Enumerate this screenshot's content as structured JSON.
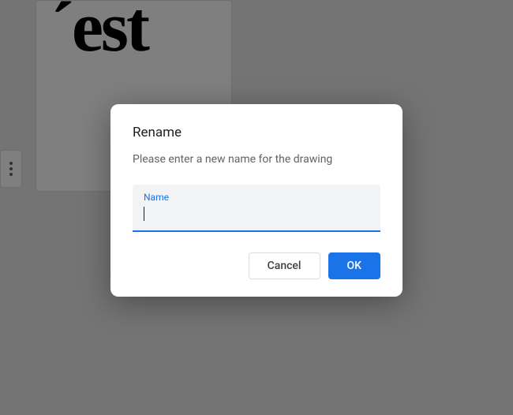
{
  "background": {
    "drawing_text": "´est"
  },
  "dialog": {
    "title": "Rename",
    "description": "Please enter a new name for the drawing",
    "input": {
      "label": "Name",
      "value": ""
    },
    "buttons": {
      "cancel": "Cancel",
      "ok": "OK"
    }
  }
}
